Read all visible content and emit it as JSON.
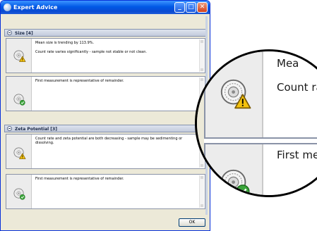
{
  "window": {
    "title": "Expert Advice",
    "controls": {
      "minimize": "_",
      "maximize": "□",
      "close": "✕"
    }
  },
  "sections": [
    {
      "title": "Size [4]",
      "rows": [
        {
          "icon": "size-warning-icon",
          "lines": [
            "Mean size is trending by 113.9%.",
            "Count rate varies significantly - sample not stable or not clean."
          ]
        },
        {
          "icon": "size-ok-icon",
          "lines": [
            "First measurement is representative of remainder."
          ]
        }
      ]
    },
    {
      "title": "Zeta Potential [3]",
      "rows": [
        {
          "icon": "zeta-warning-icon",
          "lines": [
            "Count rate and zeta potential are both decreasing - sample may be sedimenting or dissolving."
          ]
        },
        {
          "icon": "zeta-ok-icon",
          "lines": [
            "First measurement is representative of remainder."
          ]
        }
      ]
    }
  ],
  "footer": {
    "ok_label": "OK"
  },
  "magnifier": {
    "row1_lines": [
      "Mea",
      "Count rate"
    ],
    "row2_lines": [
      "First meas"
    ]
  },
  "colors": {
    "titlebar": "#0058e6",
    "window_face": "#ece9d8",
    "warning": "#f4c20d",
    "ok": "#3aa53a"
  }
}
